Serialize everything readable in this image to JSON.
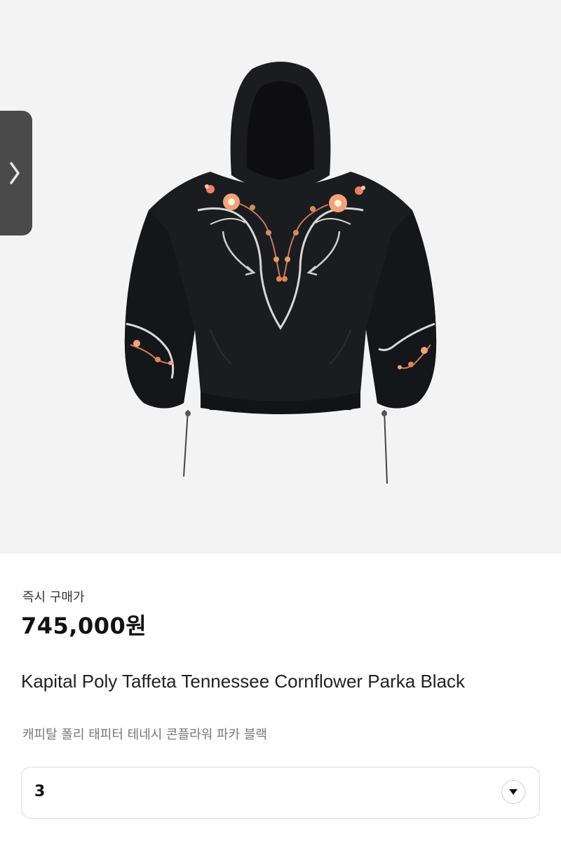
{
  "product": {
    "price_label": "즉시 구매가",
    "price": "745,000원",
    "title_en": "Kapital Poly Taffeta Tennessee Cornflower Parka Black",
    "title_ko": "캐피탈 폴리 태피터 테네시 콘플라워 파카 블랙"
  },
  "size_select": {
    "selected": "3"
  },
  "icons": {
    "carousel": "chevron-right-icon",
    "select": "caret-down-icon"
  },
  "colors": {
    "jacket": "#1b1c20",
    "embroidery_flower": "#f2a27a",
    "piping": "#d8d8d8",
    "background": "#f3f3f3"
  }
}
